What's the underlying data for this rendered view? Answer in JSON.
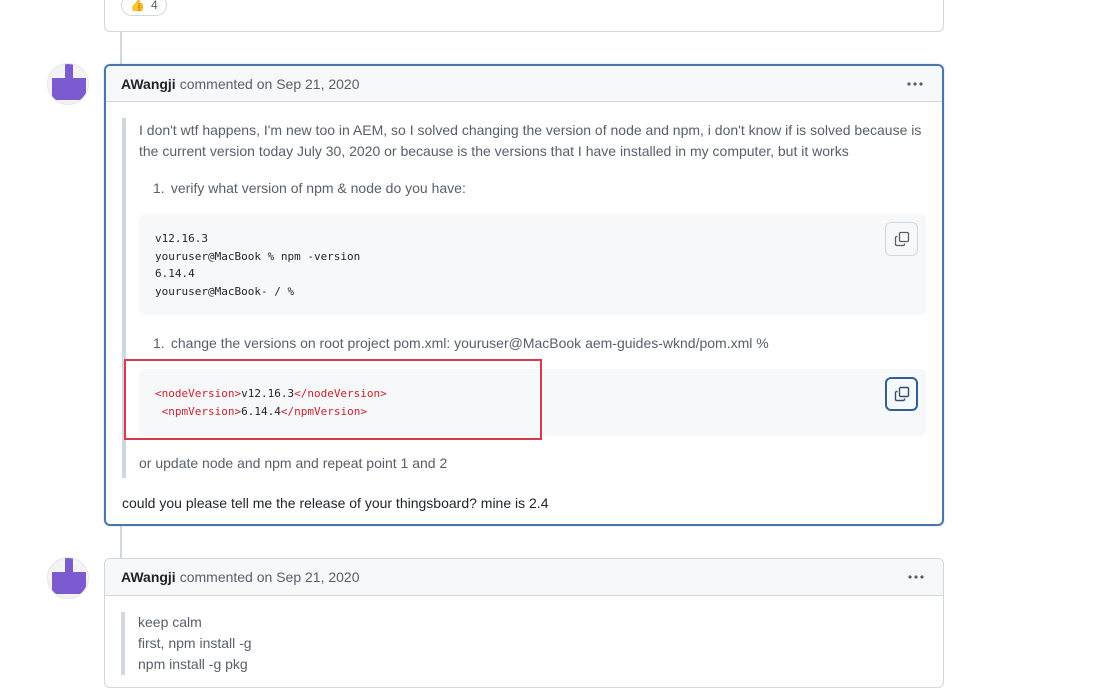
{
  "prev_comment": {
    "reaction": {
      "emoji": "👍",
      "count": "4"
    }
  },
  "comment1": {
    "author": "AWangji",
    "meta": "commented on Sep 21, 2020",
    "quote_intro": "I don't wtf happens, I'm new too in AEM, so I solved changing the version of node and npm, i don't know if is solved because is the current version today July 30, 2020 or because is the versions that I have installed in my computer, but it works",
    "step1_num": "1.",
    "step1_text": "verify what version of npm & node do you have:",
    "code1_lines": [
      "v12.16.3",
      "youruser@MacBook % npm -version",
      "6.14.4",
      "youruser@MacBook- / %"
    ],
    "step2_num": "1.",
    "step2_text": "change the versions on root project pom.xml: youruser@MacBook aem-guides-wknd/pom.xml %",
    "code2": {
      "line1_open": "<nodeVersion>",
      "line1_value": "v12.16.3",
      "line1_close": "</nodeVersion>",
      "line2_indent": " ",
      "line2_open": "<npmVersion>",
      "line2_value": "6.14.4",
      "line2_close": "</npmVersion>"
    },
    "quote_outro": "or update node and npm and repeat point 1 and 2",
    "body_text": "could you please tell me the release of your thingsboard? mine is 2.4"
  },
  "comment2": {
    "author": "AWangji",
    "meta": "commented on Sep 21, 2020",
    "quote_lines": [
      "keep calm",
      "first, npm install -g",
      "npm install -g pkg"
    ]
  },
  "colors": {
    "selected_border": "#4a76ad",
    "highlight_box": "#d93a49",
    "avatar_purple": "#7c5bd0",
    "tag_red": "#cf222e"
  },
  "icons": [
    "avatar-icon",
    "kebab-menu-icon",
    "copy-icon",
    "thumbs-up-icon"
  ]
}
